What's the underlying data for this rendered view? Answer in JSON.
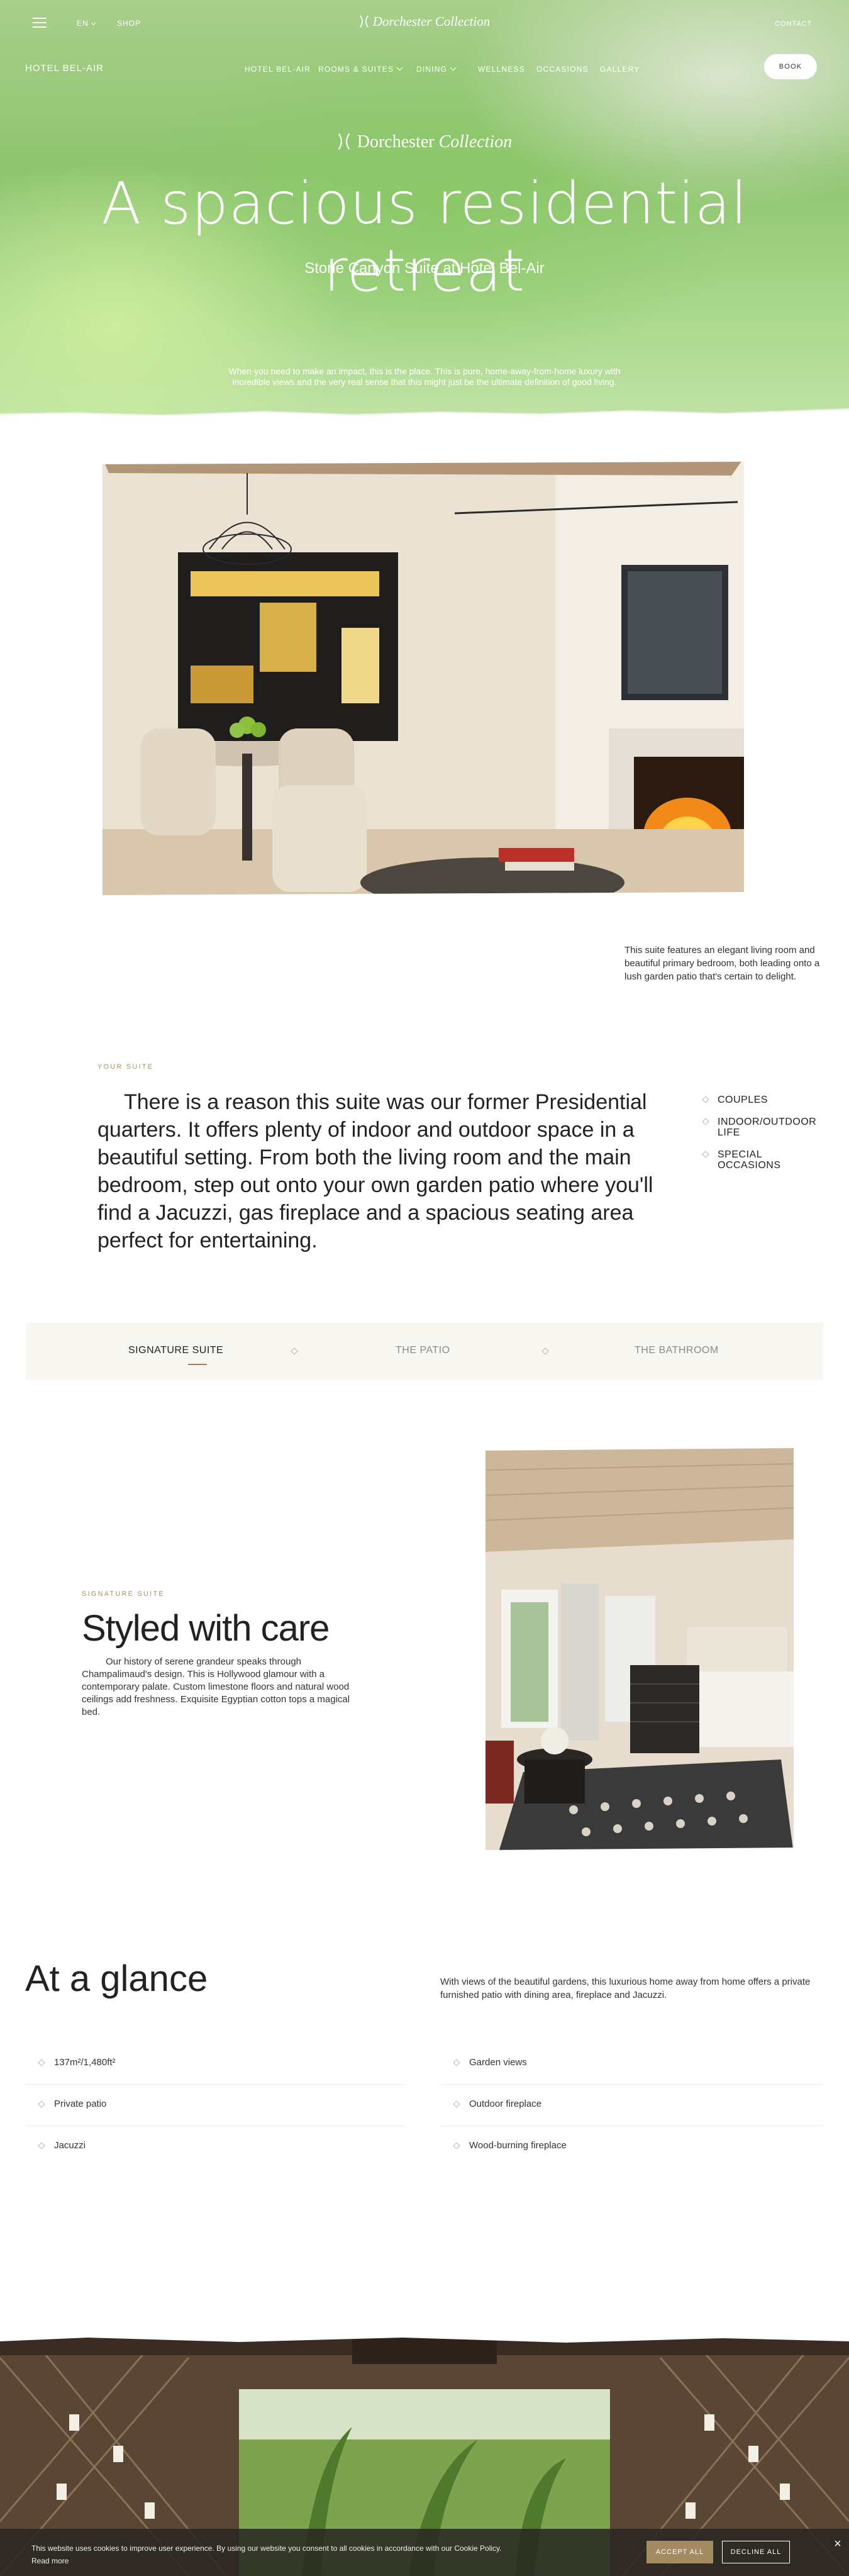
{
  "topbar": {
    "language": "EN",
    "shop": "SHOP",
    "brand": "Dorchester Collection",
    "contact": "CONTACT"
  },
  "nav": {
    "hotel_name": "HOTEL BEL-AIR",
    "items": [
      {
        "label": "HOTEL BEL-AIR",
        "has_dropdown": false
      },
      {
        "label": "ROOMS & SUITES",
        "has_dropdown": true
      },
      {
        "label": "DINING",
        "has_dropdown": true
      },
      {
        "label": "WELLNESS",
        "has_dropdown": false
      },
      {
        "label": "OCCASIONS",
        "has_dropdown": false
      },
      {
        "label": "GALLERY",
        "has_dropdown": false
      }
    ],
    "book": "BOOK"
  },
  "hero": {
    "logo_main": "Dorchester",
    "logo_italic": "Collection",
    "title": "A spacious residential retreat",
    "subtitle": "Stone Canyon Suite at Hotel Bel-Air",
    "description": "When you need to make an impact, this is the place. This is pure, home-away-from-home luxury with incredible views and the very real sense that this might just be the ultimate definition of good living."
  },
  "intro": {
    "caption": "This suite features an elegant living room and beautiful primary bedroom, both leading onto a lush garden patio that's certain to delight."
  },
  "your_suite": {
    "eyebrow": "YOUR SUITE",
    "text": "There is a reason this suite was our former Presidential quarters. It offers plenty of indoor and outdoor space in a beautiful setting. From both the living room and the main bedroom, step out onto your own garden patio where you'll find a Jacuzzi, gas fireplace and a spacious seating area perfect for entertaining.",
    "tags": [
      "COUPLES",
      "INDOOR/OUTDOOR LIFE",
      "SPECIAL OCCASIONS"
    ]
  },
  "tabs": [
    {
      "label": "SIGNATURE SUITE",
      "active": true
    },
    {
      "label": "THE PATIO",
      "active": false
    },
    {
      "label": "THE BATHROOM",
      "active": false
    }
  ],
  "care": {
    "eyebrow": "SIGNATURE SUITE",
    "title": "Styled with care",
    "text": "Our history of serene grandeur speaks through Champalimaud's design. This is Hollywood glamour with a contemporary palate. Custom limestone floors and natural wood ceilings add freshness. Exquisite Egyptian cotton tops a magical bed."
  },
  "glance": {
    "title": "At a glance",
    "description": "With views of the beautiful gardens, this luxurious home away from home offers a private furnished patio with dining area, fireplace and Jacuzzi.",
    "left_features": [
      "137m²/1,480ft²",
      "Private patio",
      "Jacuzzi"
    ],
    "right_features": [
      "Garden views",
      "Outdoor fireplace",
      "Wood-burning fireplace"
    ]
  },
  "cookie": {
    "text": "This website uses cookies to improve user experience. By using our website you consent to all cookies in accordance with our Cookie Policy.",
    "read_more": "Read more",
    "accept": "ACCEPT ALL",
    "decline": "DECLINE ALL",
    "close": "×"
  },
  "colors": {
    "accent_gold": "#a8926a",
    "tab_underline": "#b47a5a",
    "tab_background": "#f7f6f1"
  }
}
